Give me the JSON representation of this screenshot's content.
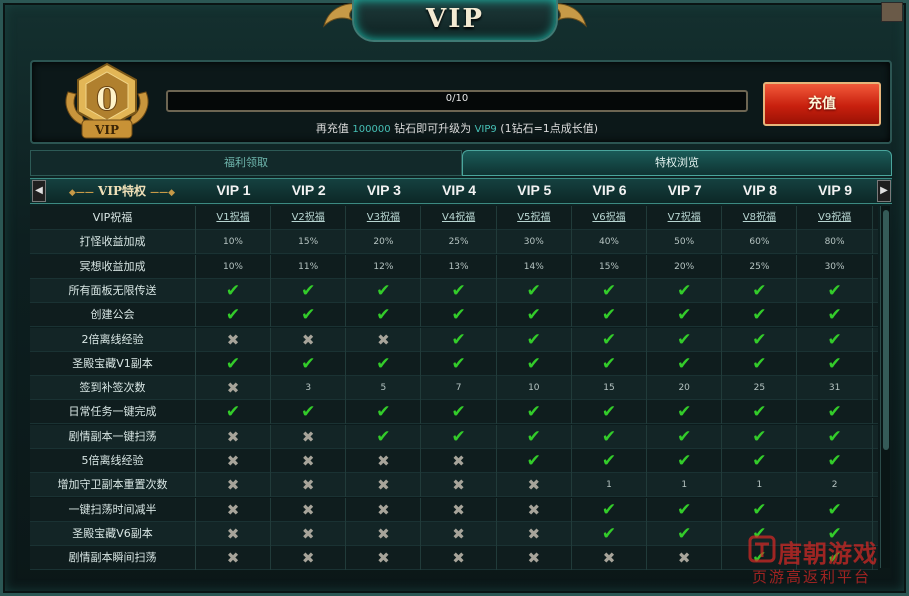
{
  "window": {
    "title": "VIP"
  },
  "vip_status": {
    "current_level": "0",
    "badge_label": "VIP",
    "progress": {
      "text": "0/10",
      "fraction": 0
    }
  },
  "recharge_hint": {
    "prefix": "再充值",
    "amount": "100000",
    "middle": "钻石即可升级为",
    "target": "VIP9",
    "suffix": "(1钻石=1点成长值)"
  },
  "recharge_button": {
    "label": "充值"
  },
  "tabs": [
    {
      "label": "福利领取",
      "active": false
    },
    {
      "label": "特权浏览",
      "active": true
    }
  ],
  "table": {
    "feature_header": "VIP特权",
    "header_decor": "◆——",
    "header_decor_r": "——◆",
    "columns": [
      "VIP 1",
      "VIP 2",
      "VIP 3",
      "VIP 4",
      "VIP 5",
      "VIP 6",
      "VIP 7",
      "VIP 8",
      "VIP 9"
    ],
    "rows": [
      {
        "label": "VIP祝福",
        "kind": "link",
        "values": [
          "V1祝福",
          "V2祝福",
          "V3祝福",
          "V4祝福",
          "V5祝福",
          "V6祝福",
          "V7祝福",
          "V8祝福",
          "V9祝福"
        ]
      },
      {
        "label": "打怪收益加成",
        "kind": "text",
        "values": [
          "10%",
          "15%",
          "20%",
          "25%",
          "30%",
          "40%",
          "50%",
          "60%",
          "80%"
        ]
      },
      {
        "label": "冥想收益加成",
        "kind": "text",
        "values": [
          "10%",
          "11%",
          "12%",
          "13%",
          "14%",
          "15%",
          "20%",
          "25%",
          "30%"
        ]
      },
      {
        "label": "所有面板无限传送",
        "kind": "mark",
        "values": [
          "check",
          "check",
          "check",
          "check",
          "check",
          "check",
          "check",
          "check",
          "check"
        ]
      },
      {
        "label": "创建公会",
        "kind": "mark",
        "values": [
          "check",
          "check",
          "check",
          "check",
          "check",
          "check",
          "check",
          "check",
          "check"
        ]
      },
      {
        "label": "2倍离线经验",
        "kind": "mark",
        "values": [
          "cross",
          "cross",
          "cross",
          "check",
          "check",
          "check",
          "check",
          "check",
          "check"
        ]
      },
      {
        "label": "圣殿宝藏V1副本",
        "kind": "mark",
        "values": [
          "check",
          "check",
          "check",
          "check",
          "check",
          "check",
          "check",
          "check",
          "check"
        ]
      },
      {
        "label": "签到补签次数",
        "kind": "mixed",
        "values": [
          "cross",
          "3",
          "5",
          "7",
          "10",
          "15",
          "20",
          "25",
          "31"
        ]
      },
      {
        "label": "日常任务一键完成",
        "kind": "mark",
        "values": [
          "check",
          "check",
          "check",
          "check",
          "check",
          "check",
          "check",
          "check",
          "check"
        ]
      },
      {
        "label": "剧情副本一键扫荡",
        "kind": "mark",
        "values": [
          "cross",
          "cross",
          "check",
          "check",
          "check",
          "check",
          "check",
          "check",
          "check"
        ]
      },
      {
        "label": "5倍离线经验",
        "kind": "mark",
        "values": [
          "cross",
          "cross",
          "cross",
          "cross",
          "check",
          "check",
          "check",
          "check",
          "check"
        ]
      },
      {
        "label": "增加守卫副本重置次数",
        "kind": "mixed",
        "values": [
          "cross",
          "cross",
          "cross",
          "cross",
          "cross",
          "1",
          "1",
          "1",
          "2"
        ]
      },
      {
        "label": "一键扫荡时间减半",
        "kind": "mark",
        "values": [
          "cross",
          "cross",
          "cross",
          "cross",
          "cross",
          "check",
          "check",
          "check",
          "check"
        ]
      },
      {
        "label": "圣殿宝藏V6副本",
        "kind": "mark",
        "values": [
          "cross",
          "cross",
          "cross",
          "cross",
          "cross",
          "check",
          "check",
          "check",
          "check"
        ]
      },
      {
        "label": "剧情副本瞬间扫荡",
        "kind": "mark",
        "values": [
          "cross",
          "cross",
          "cross",
          "cross",
          "cross",
          "cross",
          "cross",
          "check",
          "check"
        ]
      }
    ]
  },
  "icons": {
    "check": "✔",
    "cross": "✖",
    "arrow_left": "◀",
    "arrow_right": "▶"
  },
  "watermark": {
    "brand": "唐朝游戏",
    "slogan": "页游高返利平台"
  },
  "colors": {
    "check": "#33cc2a",
    "cross": "#a7a49a",
    "accent": "#46c0b6",
    "recharge": "#c8200e"
  }
}
